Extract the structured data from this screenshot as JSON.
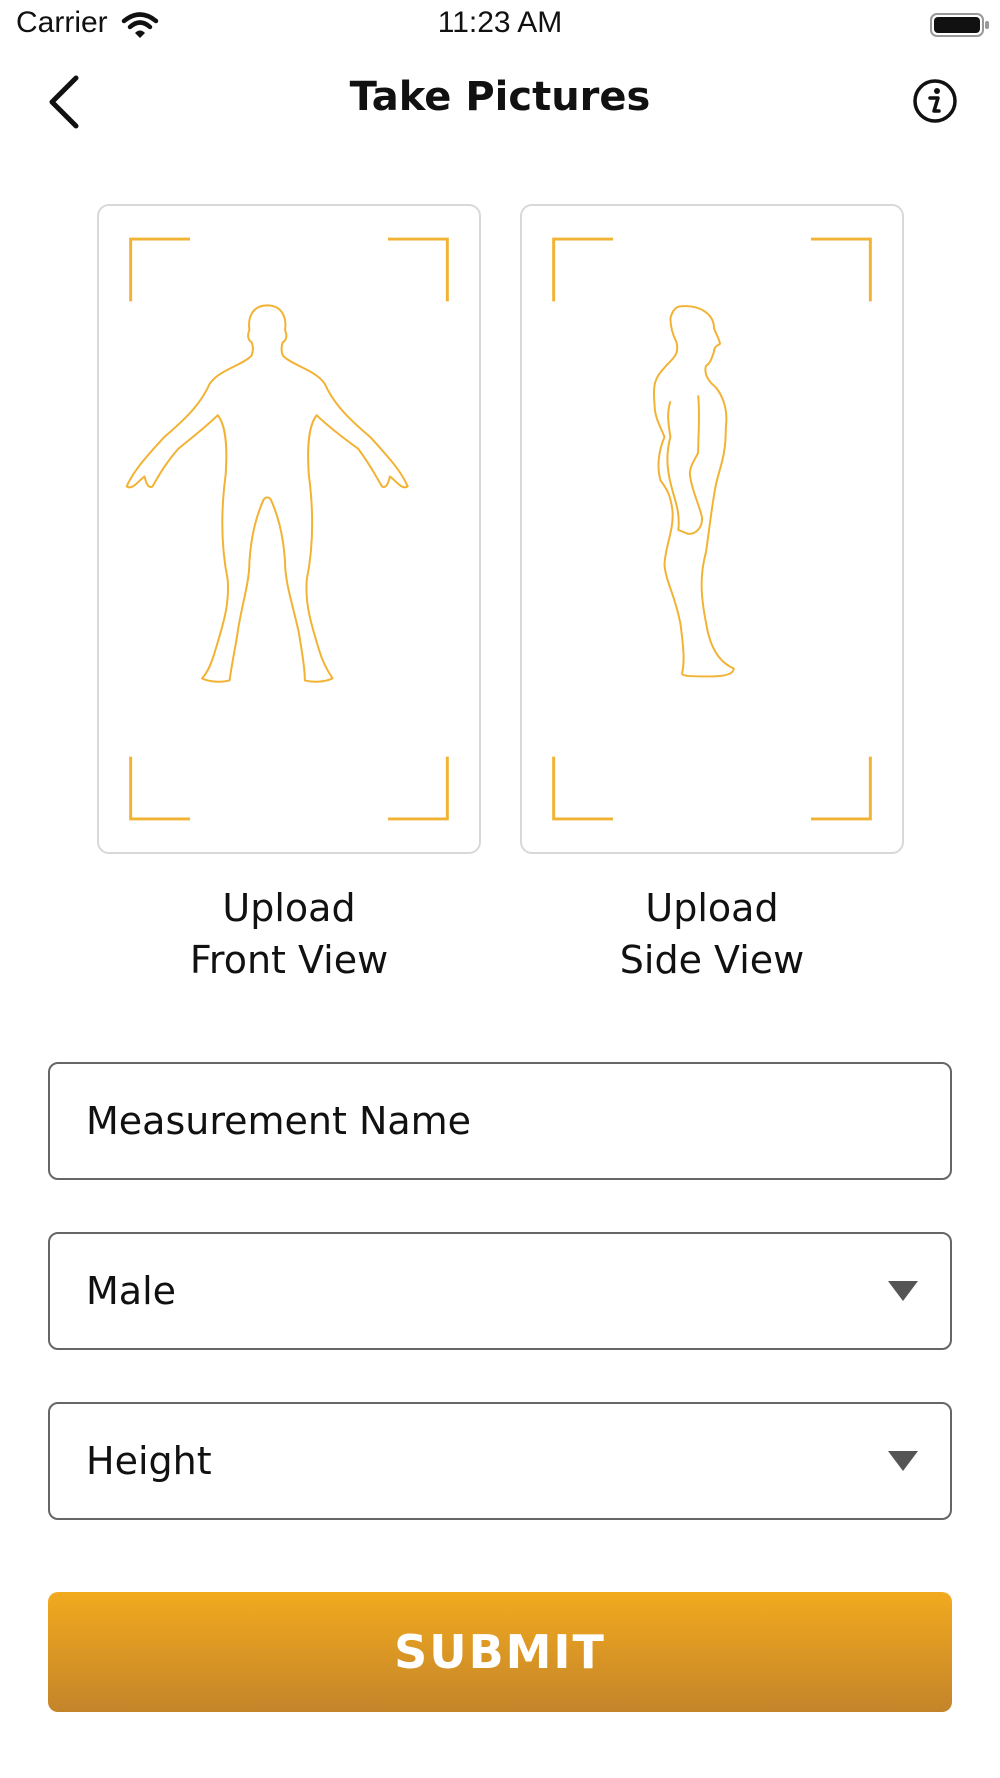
{
  "status_bar": {
    "carrier": "Carrier",
    "time": "11:23 AM"
  },
  "header": {
    "title": "Take Pictures"
  },
  "uploads": [
    {
      "line1": "Upload",
      "line2": "Front View"
    },
    {
      "line1": "Upload",
      "line2": "Side View"
    }
  ],
  "form": {
    "measurement_name_placeholder": "Measurement Name",
    "gender_value": "Male",
    "height_value": "Height"
  },
  "submit_label": "SUBMIT",
  "colors": {
    "accent": "#f2b233",
    "button_top": "#f2aa1e",
    "button_bottom": "#c4842a"
  }
}
